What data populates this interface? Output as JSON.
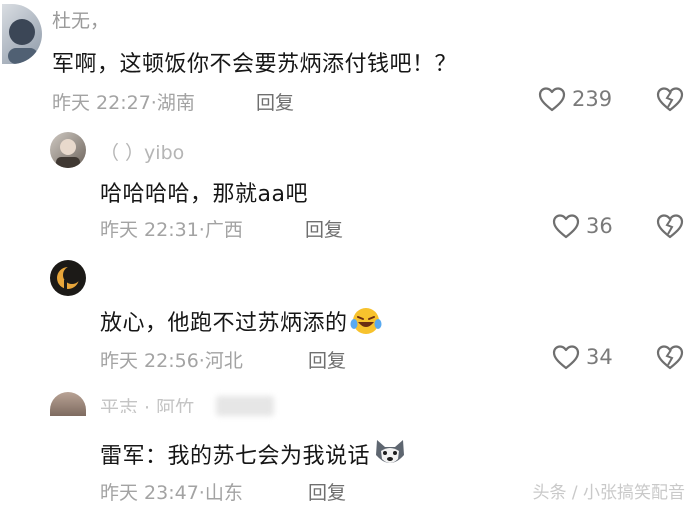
{
  "comments": [
    {
      "username": "杜无，",
      "text": "军啊，这顿饭你不会要苏炳添付钱吧！？",
      "time": "昨天 22:27",
      "location": "湖南",
      "reply_label": "回复",
      "likes": "239",
      "avatar_icon": "user-avatar"
    },
    {
      "username": "（ ）yibo",
      "text": "哈哈哈哈，那就aa吧",
      "time": "昨天 22:31",
      "location": "广西",
      "reply_label": "回复",
      "likes": "36",
      "avatar_icon": "user-avatar"
    },
    {
      "username": "",
      "text": "放心，他跑不过苏炳添的",
      "emoji": "laughing-tears-emoji",
      "time": "昨天 22:56",
      "location": "河北",
      "reply_label": "回复",
      "likes": "34",
      "avatar_icon": "moon-avatar"
    },
    {
      "username": "平志 · 阿竹",
      "text": "雷军：我的苏七会为我说话",
      "emoji": "husky-dog-emoji",
      "time": "昨天 23:47",
      "location": "山东",
      "reply_label": "回复",
      "avatar_icon": "user-avatar"
    }
  ],
  "separator": "·",
  "watermark": "头条 / 小张搞笑配音",
  "colors": {
    "text": "#161616",
    "meta": "#a3a3a3",
    "reply": "#6f6f6f",
    "like_icon": "#6f6f6f"
  }
}
